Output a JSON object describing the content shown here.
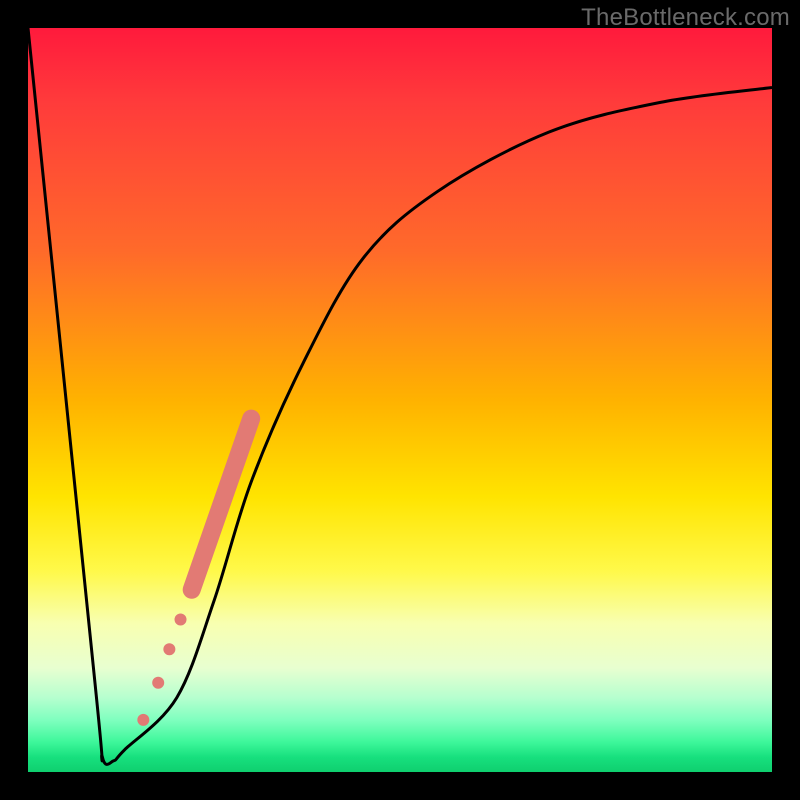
{
  "watermark": "TheBottleneck.com",
  "colors": {
    "frame": "#000000",
    "curve_stroke": "#000000",
    "marker_fill": "#e27a74",
    "gradient_top": "#ff1a3c",
    "gradient_bottom": "#0fcf6f"
  },
  "chart_data": {
    "type": "line",
    "title": "",
    "xlabel": "",
    "ylabel": "",
    "xlim": [
      0,
      100
    ],
    "ylim": [
      0,
      100
    ],
    "grid": false,
    "legend": false,
    "series": [
      {
        "name": "bottleneck-curve",
        "x": [
          0,
          9,
          10,
          11.5,
          13,
          20,
          25,
          30,
          37,
          45,
          55,
          70,
          85,
          100
        ],
        "y": [
          100,
          12,
          2,
          1.5,
          3,
          10,
          23,
          39,
          55,
          69,
          78,
          86,
          90,
          92
        ]
      }
    ],
    "markers": [
      {
        "x": 15.5,
        "y": 7.0,
        "r": 6
      },
      {
        "x": 17.5,
        "y": 12.0,
        "r": 6
      },
      {
        "x": 19.0,
        "y": 16.5,
        "r": 6
      },
      {
        "x": 20.5,
        "y": 20.5,
        "r": 6
      },
      {
        "x": 22.0,
        "y": 24.5,
        "r": 9
      },
      {
        "x": 26.5,
        "y": 37.0,
        "r": 9
      },
      {
        "x": 30.0,
        "y": 47.5,
        "r": 9
      }
    ]
  }
}
